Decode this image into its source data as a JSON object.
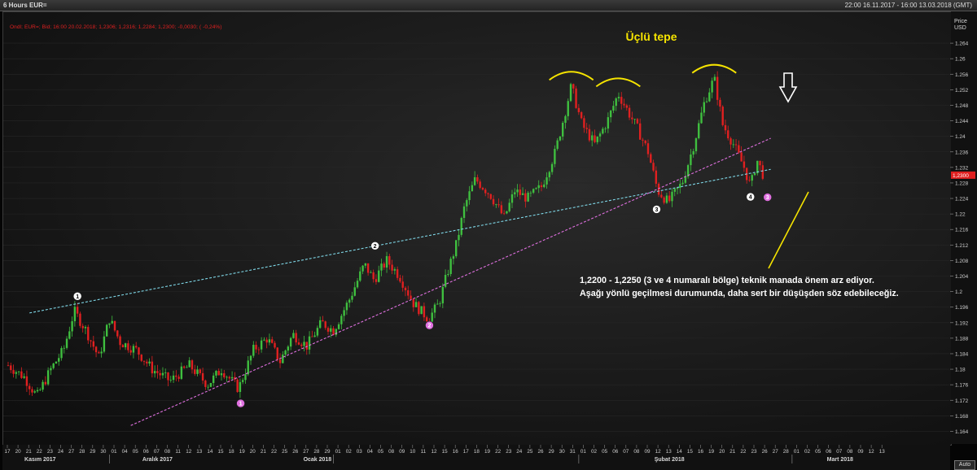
{
  "window": {
    "title": "6 Hours EUR=",
    "date_range": "22:00 16.11.2017 - 16:00 13.03.2018 (GMT)"
  },
  "legend_text": "Ondl; EUR=; Bid; 16:00 20.02.2018; 1,2306; 1,2316; 1,2284; 1,2300; -0,0030; ( -0,24%)",
  "y_axis": {
    "title_line1": "Price",
    "title_line2": "USD",
    "current_price_label": "1,2300",
    "ticks": [
      {
        "label": "1.264",
        "v": 1.264
      },
      {
        "label": "1.26",
        "v": 1.26
      },
      {
        "label": "1.256",
        "v": 1.256
      },
      {
        "label": "1.252",
        "v": 1.252
      },
      {
        "label": "1.248",
        "v": 1.248
      },
      {
        "label": "1.244",
        "v": 1.244
      },
      {
        "label": "1.24",
        "v": 1.24
      },
      {
        "label": "1.236",
        "v": 1.236
      },
      {
        "label": "1.232",
        "v": 1.232
      },
      {
        "label": "1.228",
        "v": 1.228
      },
      {
        "label": "1.224",
        "v": 1.224
      },
      {
        "label": "1.22",
        "v": 1.22
      },
      {
        "label": "1.216",
        "v": 1.216
      },
      {
        "label": "1.212",
        "v": 1.212
      },
      {
        "label": "1.208",
        "v": 1.208
      },
      {
        "label": "1.204",
        "v": 1.204
      },
      {
        "label": "1.2",
        "v": 1.2
      },
      {
        "label": "1.196",
        "v": 1.196
      },
      {
        "label": "1.192",
        "v": 1.192
      },
      {
        "label": "1.188",
        "v": 1.188
      },
      {
        "label": "1.184",
        "v": 1.184
      },
      {
        "label": "1.18",
        "v": 1.18
      },
      {
        "label": "1.176",
        "v": 1.176
      },
      {
        "label": "1.172",
        "v": 1.172
      },
      {
        "label": "1.168",
        "v": 1.168
      },
      {
        "label": "1.164",
        "v": 1.164
      }
    ]
  },
  "x_axis": {
    "day_labels": [
      "17",
      "20",
      "21",
      "22",
      "23",
      "24",
      "27",
      "28",
      "29",
      "30",
      "01",
      "04",
      "05",
      "06",
      "07",
      "08",
      "11",
      "12",
      "13",
      "14",
      "15",
      "18",
      "19",
      "20",
      "21",
      "22",
      "25",
      "26",
      "27",
      "28",
      "29",
      "01",
      "02",
      "03",
      "04",
      "05",
      "08",
      "09",
      "10",
      "11",
      "12",
      "15",
      "16",
      "17",
      "18",
      "19",
      "22",
      "23",
      "24",
      "25",
      "26",
      "29",
      "30",
      "31",
      "01",
      "02",
      "05",
      "06",
      "07",
      "08",
      "09",
      "12",
      "13",
      "14",
      "15",
      "16",
      "19",
      "20",
      "21",
      "22",
      "23",
      "26",
      "27",
      "28",
      "01",
      "02",
      "05",
      "06",
      "07",
      "08",
      "09",
      "12",
      "13"
    ],
    "month_labels": [
      {
        "label": "Kasım 2017",
        "day_index": 3
      },
      {
        "label": "Aralık 2017",
        "day_index": 14
      },
      {
        "label": "Ocak 2018",
        "day_index": 29
      },
      {
        "label": "Şubat 2018",
        "day_index": 62
      },
      {
        "label": "Mart 2018",
        "day_index": 78
      }
    ],
    "month_separators_day_index": [
      9.5,
      30.5,
      53.5,
      73.5
    ],
    "auto_button": "Auto"
  },
  "annotations": {
    "pattern_title": "Üçlü tepe",
    "note_line1": "1,2200 - 1,2250 (3 ve 4 numaralı bölge) teknik manada önem arz ediyor.",
    "note_line2": "Aşağı yönlü geçilmesi durumunda, daha sert bir düşüşden söz edebileceğiz.",
    "white_markers": [
      {
        "label": "1",
        "day": 6.5,
        "price": 1.1988
      },
      {
        "label": "2",
        "day": 34.4,
        "price": 1.2118
      },
      {
        "label": "3",
        "day": 60.8,
        "price": 1.2212
      },
      {
        "label": "4",
        "day": 69.6,
        "price": 1.2244
      }
    ],
    "pink_markers": [
      {
        "label": "1",
        "day": 21.8,
        "price": 1.1712
      },
      {
        "label": "2",
        "day": 39.5,
        "price": 1.1913
      },
      {
        "label": "3",
        "day": 71.2,
        "price": 1.2243
      }
    ]
  },
  "colors": {
    "up_candle": "#3fbf3f",
    "down_candle": "#e02020",
    "resistance_line": "#7fd8e8",
    "support_line": "#e070e0",
    "annotation_yellow": "#f5e300",
    "pink_marker": "#e070e0"
  },
  "chart_data": {
    "type": "candlestick",
    "series_type": "EUR/USD 6-hour bid",
    "ylim": [
      1.162,
      1.268
    ],
    "close_path": [
      {
        "day": 0,
        "price": 1.181
      },
      {
        "day": 1.5,
        "price": 1.178
      },
      {
        "day": 2.7,
        "price": 1.173
      },
      {
        "day": 4.0,
        "price": 1.18
      },
      {
        "day": 5.2,
        "price": 1.185
      },
      {
        "day": 6.2,
        "price": 1.195
      },
      {
        "day": 7.3,
        "price": 1.19
      },
      {
        "day": 8.5,
        "price": 1.183
      },
      {
        "day": 9.5,
        "price": 1.193
      },
      {
        "day": 10.5,
        "price": 1.187
      },
      {
        "day": 12.0,
        "price": 1.185
      },
      {
        "day": 13.5,
        "price": 1.18
      },
      {
        "day": 15.2,
        "price": 1.177
      },
      {
        "day": 17.0,
        "price": 1.181
      },
      {
        "day": 18.7,
        "price": 1.176
      },
      {
        "day": 20.0,
        "price": 1.18
      },
      {
        "day": 21.6,
        "price": 1.175
      },
      {
        "day": 23.0,
        "price": 1.185
      },
      {
        "day": 24.3,
        "price": 1.188
      },
      {
        "day": 25.5,
        "price": 1.182
      },
      {
        "day": 26.7,
        "price": 1.189
      },
      {
        "day": 28.0,
        "price": 1.186
      },
      {
        "day": 29.4,
        "price": 1.192
      },
      {
        "day": 30.5,
        "price": 1.19
      },
      {
        "day": 32.0,
        "price": 1.198
      },
      {
        "day": 33.4,
        "price": 1.207
      },
      {
        "day": 34.3,
        "price": 1.203
      },
      {
        "day": 35.5,
        "price": 1.208
      },
      {
        "day": 36.7,
        "price": 1.204
      },
      {
        "day": 38.0,
        "price": 1.197
      },
      {
        "day": 39.4,
        "price": 1.193
      },
      {
        "day": 40.4,
        "price": 1.197
      },
      {
        "day": 41.2,
        "price": 1.205
      },
      {
        "day": 42.0,
        "price": 1.212
      },
      {
        "day": 42.8,
        "price": 1.222
      },
      {
        "day": 43.8,
        "price": 1.229
      },
      {
        "day": 45.2,
        "price": 1.225
      },
      {
        "day": 46.5,
        "price": 1.219
      },
      {
        "day": 47.5,
        "price": 1.226
      },
      {
        "day": 48.7,
        "price": 1.224
      },
      {
        "day": 50.0,
        "price": 1.227
      },
      {
        "day": 51.3,
        "price": 1.236
      },
      {
        "day": 52.2,
        "price": 1.246
      },
      {
        "day": 52.8,
        "price": 1.253
      },
      {
        "day": 53.8,
        "price": 1.243
      },
      {
        "day": 55.0,
        "price": 1.238
      },
      {
        "day": 56.2,
        "price": 1.244
      },
      {
        "day": 57.2,
        "price": 1.251
      },
      {
        "day": 58.0,
        "price": 1.247
      },
      {
        "day": 59.0,
        "price": 1.242
      },
      {
        "day": 60.0,
        "price": 1.236
      },
      {
        "day": 60.9,
        "price": 1.226
      },
      {
        "day": 61.9,
        "price": 1.223
      },
      {
        "day": 63.2,
        "price": 1.228
      },
      {
        "day": 64.3,
        "price": 1.238
      },
      {
        "day": 65.3,
        "price": 1.249
      },
      {
        "day": 66.2,
        "price": 1.255
      },
      {
        "day": 67.0,
        "price": 1.243
      },
      {
        "day": 68.0,
        "price": 1.238
      },
      {
        "day": 69.0,
        "price": 1.232
      },
      {
        "day": 69.6,
        "price": 1.227
      },
      {
        "day": 70.2,
        "price": 1.234
      },
      {
        "day": 70.8,
        "price": 1.23
      }
    ],
    "trendlines": [
      {
        "name": "resistance",
        "from": {
          "day": 2.0,
          "price": 1.1945
        },
        "to": {
          "day": 71.5,
          "price": 1.2315
        }
      },
      {
        "name": "support",
        "from": {
          "day": 11.5,
          "price": 1.1655
        },
        "to": {
          "day": 71.5,
          "price": 1.2395
        }
      }
    ],
    "peaks": [
      {
        "day": 52.8,
        "price": 1.2537
      },
      {
        "day": 57.2,
        "price": 1.252
      },
      {
        "day": 66.2,
        "price": 1.2555
      }
    ]
  }
}
